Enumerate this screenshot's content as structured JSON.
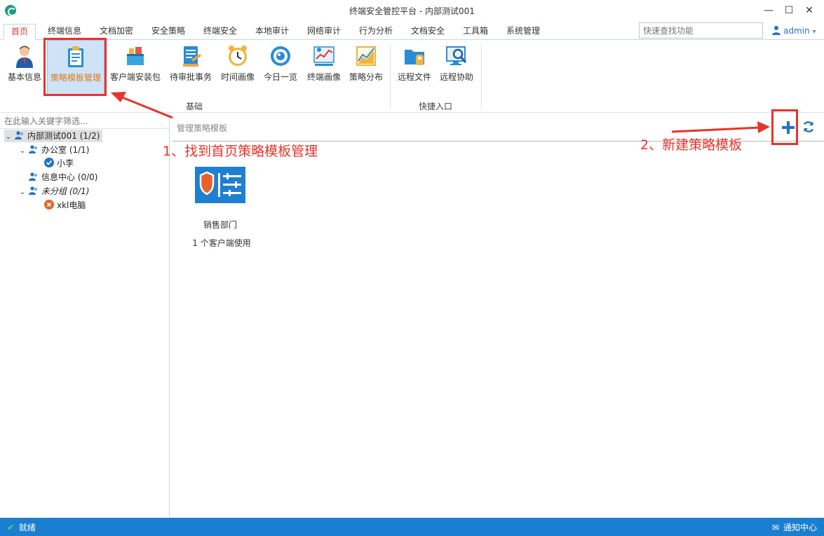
{
  "window": {
    "title": "终端安全管控平台 - 内部测试001",
    "minimize": "—",
    "maximize": "☐",
    "close": "✕"
  },
  "menu": {
    "tabs": [
      "首页",
      "终端信息",
      "文档加密",
      "安全策略",
      "终端安全",
      "本地审计",
      "网络审计",
      "行为分析",
      "文档安全",
      "工具箱",
      "系统管理"
    ],
    "active_index": 0,
    "search_placeholder": "快速查找功能",
    "user_label": "admin",
    "user_caret": "▾"
  },
  "ribbon": {
    "items": [
      {
        "label": "基本信息",
        "icon": "person-icon"
      },
      {
        "label": "策略模板管理",
        "icon": "clipboard-icon",
        "selected": true
      },
      {
        "label": "客户端安装包",
        "icon": "package-icon"
      },
      {
        "label": "待审批事务",
        "icon": "approval-icon"
      },
      {
        "label": "时间画像",
        "icon": "clock-icon"
      },
      {
        "label": "今日一览",
        "icon": "eye-icon"
      },
      {
        "label": "终端画像",
        "icon": "profile-chart-icon"
      },
      {
        "label": "策略分布",
        "icon": "distribution-chart-icon"
      },
      {
        "label": "远程文件",
        "icon": "remote-file-icon"
      },
      {
        "label": "远程协助",
        "icon": "remote-assist-icon"
      }
    ],
    "groups": {
      "basic": "基础",
      "quick": "快捷入口"
    }
  },
  "tree": {
    "filter_placeholder": "在此输入关键字筛选...",
    "nodes": [
      {
        "label": "内部测试001 (1/2)"
      },
      {
        "label": "办公室 (1/1)"
      },
      {
        "label": "小李"
      },
      {
        "label": "信息中心 (0/0)"
      },
      {
        "label": "未分组 (0/1)"
      },
      {
        "label": "xkl电脑"
      }
    ]
  },
  "main": {
    "title": "管理策略模板",
    "card": {
      "name": "销售部门",
      "usage": "1 个客户端使用"
    }
  },
  "annotations": {
    "step1": "1、找到首页策略模板管理",
    "step2": "2、新建策略模板"
  },
  "status": {
    "left": "就绪",
    "right": "通知中心"
  },
  "colors": {
    "accent_blue": "#1b7fd1",
    "annotation_red": "#e8332a",
    "selected_bg": "#cfe3f8"
  }
}
